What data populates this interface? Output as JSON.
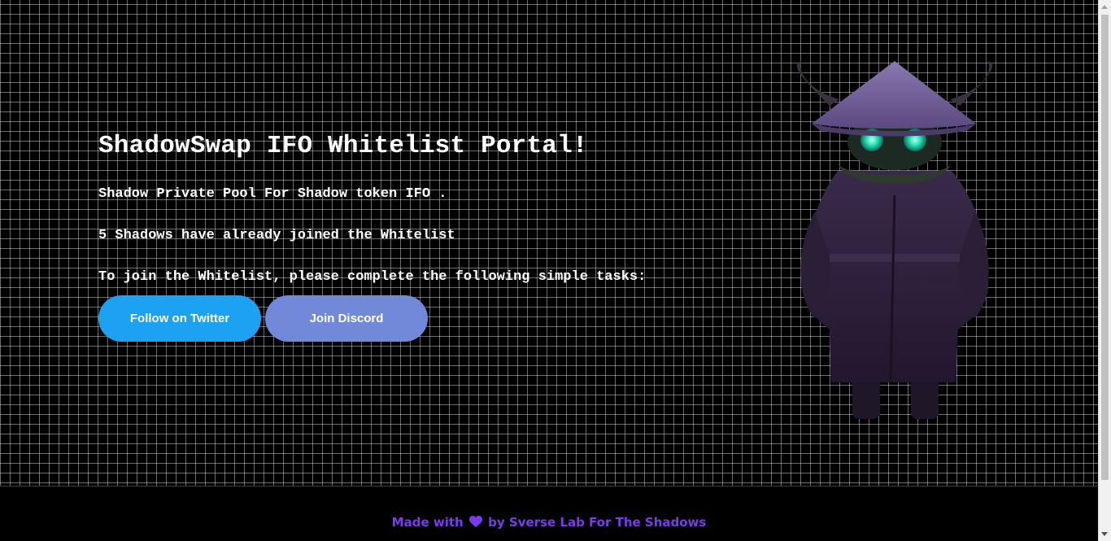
{
  "hero": {
    "title": "ShadowSwap IFO Whitelist Portal!",
    "line1": "Shadow Private Pool For Shadow token IFO .",
    "line2": "5 Shadows have already joined the Whitelist",
    "line3": "To join the Whitelist, please complete the following simple tasks:"
  },
  "buttons": {
    "twitter_label": "Follow on Twitter",
    "discord_label": "Join Discord"
  },
  "mascot": {
    "icon": "hooded-shadow-mascot"
  },
  "footer": {
    "prefix": "Made with",
    "suffix": "by Sverse Lab For The Shadows",
    "heart_icon": "heart-icon"
  },
  "colors": {
    "background": "#000000",
    "grid_line": "#6b6b6b",
    "twitter_button": "#1da1f2",
    "discord_button": "#7289da",
    "footer_text": "#7c3aed",
    "mascot_eyes": "#2ee6b8"
  }
}
